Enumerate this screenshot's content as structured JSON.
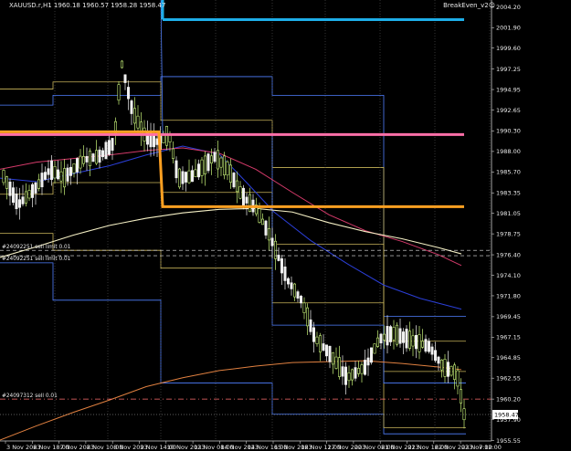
{
  "window": {
    "symbol_line": "XAUUSD.r,H1  1960.18 1960.57 1958.28 1958.47",
    "indicator_label": "BreakEven_v2"
  },
  "colors": {
    "bg": "#000000",
    "bull": "#c8f27a",
    "bear": "#f0f0f0",
    "grid": "#555555",
    "cyan_level": "#1eaee8",
    "pink_level": "#ff6fa8",
    "orange_level": "#ffa021",
    "yellow_band": "#c8b45a",
    "blue_band": "#4f7fff",
    "ma_fast": "#2b3fd8",
    "ma_mid": "#d43a6a",
    "ma_slow": "#f4efc4",
    "ma_long": "#e08040",
    "dash_red": "#ff7070"
  },
  "price_axis": {
    "min": 1955.5,
    "max": 2005.0,
    "ticks": [
      "2004.20",
      "2001.90",
      "1999.60",
      "1997.25",
      "1994.95",
      "1992.65",
      "1990.30",
      "1988.00",
      "1985.70",
      "1983.35",
      "1981.05",
      "1978.75",
      "1976.40",
      "1974.10",
      "1971.80",
      "1969.45",
      "1967.15",
      "1964.85",
      "1962.55",
      "1960.20",
      "1957.90",
      "1955.55"
    ],
    "current_price": "1958.47"
  },
  "time_axis": {
    "labels": [
      "3 Nov 2023",
      "6 Nov 18:00",
      "7 Nov 2023",
      "8 Nov 10:00",
      "8 Nov 2023",
      "9 Nov 14:00",
      "10 Nov 2023",
      "13 Nov 08:00",
      "14 Nov 2023",
      "14 Nov 16:00",
      "15 Nov 2023",
      "16 Nov 12:00",
      "17 Nov 2023",
      "20 Nov 08:00",
      "21 Nov 2023",
      "21 Nov 16:00",
      "22 Nov 2023",
      "23 Nov 12:00"
    ],
    "last_label": "7:00"
  },
  "trade_labels": {
    "upper": "#24092251 sell limit 0.01",
    "upper2": "#24092251 sell limit 0.01",
    "lower": "#24097312 sell 0.01"
  },
  "levels": {
    "cyan": 2002.8,
    "pink": 1989.9,
    "orange_left": 1990.2,
    "orange_right": 1981.8,
    "trade_upper": 1976.9,
    "trade_upper2": 1976.3,
    "trade_lower": 1960.2
  }
}
